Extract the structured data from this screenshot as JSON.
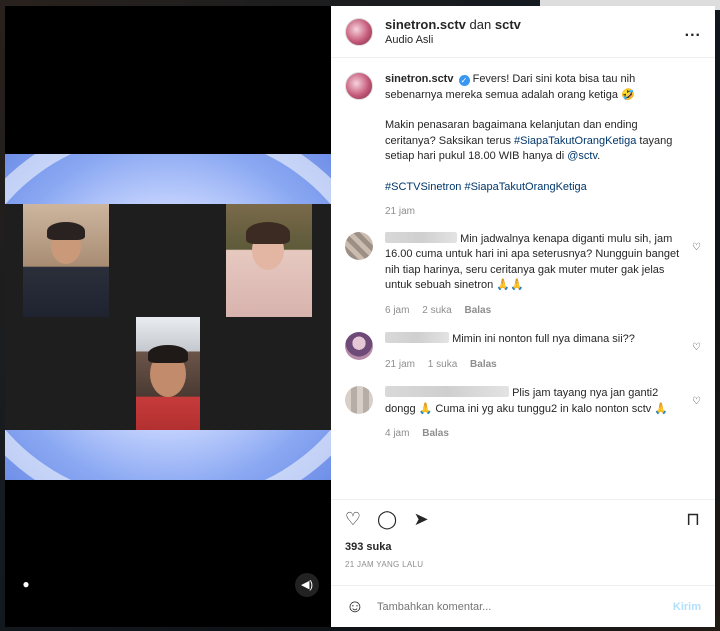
{
  "post": {
    "header": {
      "username": "sinetron.sctv",
      "coauthor_sep": "dan",
      "coauthor": "sctv",
      "audio": "Audio Asli",
      "more": "..."
    },
    "caption": {
      "username": "sinetron.sctv",
      "p1": "Fevers! Dari sini kota bisa tau nih sebenarnya mereka semua adalah orang ketiga 🤣",
      "p2a": "Makin penasaran bagaimana kelanjutan dan ending ceritanya? Saksikan terus ",
      "p2_tag": "#SiapaTakutOrangKetiga",
      "p2b": " tayang setiap hari pukul 18.00 WIB hanya di ",
      "p2_mention": "@sctv",
      "p2c": ".",
      "tags": "#SCTVSinetron #SiapaTakutOrangKetiga",
      "time": "21 jam"
    },
    "comments": [
      {
        "text": "Min jadwalnya kenapa diganti mulu sih, jam 16.00 cuma untuk hari ini apa seterusnya? Nungguin banget nih tiap harinya, seru ceritanya gak muter muter gak jelas untuk sebuah sinetron 🙏🙏",
        "time": "6 jam",
        "likes": "2 suka",
        "reply": "Balas"
      },
      {
        "text": "Mimin ini nonton full nya dimana sii??",
        "time": "21 jam",
        "likes": "1 suka",
        "reply": "Balas"
      },
      {
        "text": "Plis jam tayang nya jan ganti2 dongg 🙏 Cuma ini yg aku tunggu2 in kalo nonton sctv 🙏",
        "time": "4 jam",
        "reply": "Balas"
      }
    ],
    "likes": "393 suka",
    "date": "21 JAM YANG LALU",
    "add_comment": {
      "placeholder": "Tambahkan komentar...",
      "post_label": "Kirim"
    }
  },
  "icons": {
    "verified": "✓",
    "heart_small": "♡",
    "like": "♡",
    "comment": "◯",
    "share": "➤",
    "save": "⊓",
    "emoji": "☺",
    "person": "●",
    "sound": "◀)"
  }
}
